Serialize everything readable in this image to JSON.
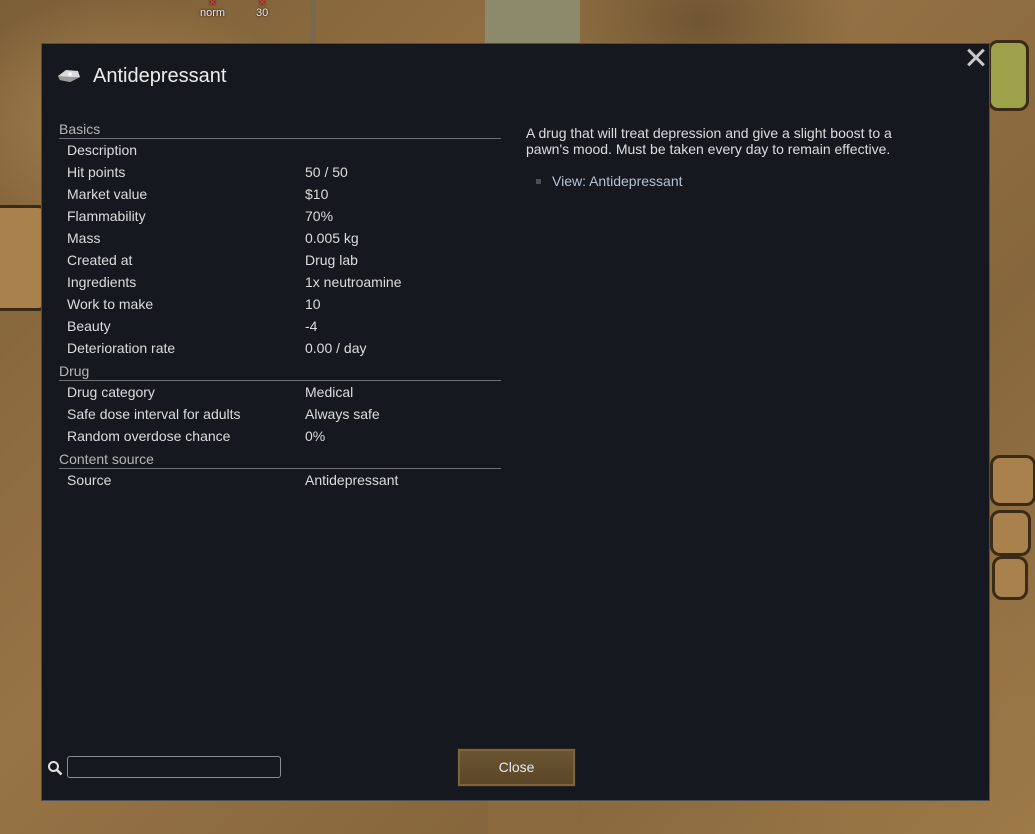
{
  "background": {
    "markers": [
      "norm",
      "30"
    ]
  },
  "dialog": {
    "icon": "drug-pill-icon",
    "title": "Antidepressant",
    "close_icon": "close-x-icon",
    "sections": [
      {
        "heading": "Basics",
        "rows": [
          {
            "label": "Description",
            "value": ""
          },
          {
            "label": "Hit points",
            "value": "50 / 50"
          },
          {
            "label": "Market value",
            "value": "$10"
          },
          {
            "label": "Flammability",
            "value": "70%"
          },
          {
            "label": "Mass",
            "value": "0.005 kg"
          },
          {
            "label": "Created at",
            "value": "Drug lab"
          },
          {
            "label": "Ingredients",
            "value": "1x neutroamine"
          },
          {
            "label": "Work to make",
            "value": "10"
          },
          {
            "label": "Beauty",
            "value": "-4"
          },
          {
            "label": "Deterioration rate",
            "value": "0.00 / day"
          }
        ]
      },
      {
        "heading": "Drug",
        "rows": [
          {
            "label": "Drug category",
            "value": "Medical"
          },
          {
            "label": "Safe dose interval for adults",
            "value": "Always safe"
          },
          {
            "label": "Random overdose chance",
            "value": "0%"
          }
        ]
      },
      {
        "heading": "Content source",
        "rows": [
          {
            "label": "Source",
            "value": "Antidepressant"
          }
        ]
      }
    ],
    "description": "A drug that will treat depression and give a slight boost to a pawn's mood. Must be taken every day to remain effective.",
    "view_link": "View: Antidepressant",
    "search": {
      "icon": "search-icon",
      "value": "",
      "placeholder": ""
    },
    "close_button": "Close"
  }
}
